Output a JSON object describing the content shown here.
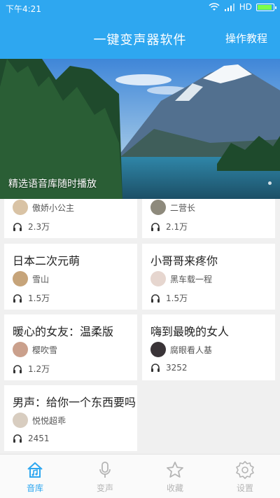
{
  "status": {
    "time": "下午4:21",
    "network": "HD"
  },
  "header": {
    "title": "一键变声器软件",
    "tutorial_label": "操作教程"
  },
  "banner": {
    "caption": "精选语音库随时播放"
  },
  "cards": [
    {
      "title": "",
      "author": "傲娇小公主",
      "plays": "2.3万"
    },
    {
      "title": "",
      "author": "二营长",
      "plays": "2.1万"
    },
    {
      "title": "日本二次元萌",
      "author": "雪山",
      "plays": "1.5万"
    },
    {
      "title": "小哥哥来疼你",
      "author": "黑车载一程",
      "plays": "1.5万"
    },
    {
      "title": "暖心的女友：温柔版",
      "author": "樱吹雪",
      "plays": "1.2万"
    },
    {
      "title": "嗨到最晚的女人",
      "author": "腐眼看人基",
      "plays": "3252"
    },
    {
      "title": "男声：给你一个东西要吗",
      "author": "悦悦超乖",
      "plays": "2451"
    }
  ],
  "nav": [
    {
      "label": "音库",
      "icon": "library-icon",
      "active": true
    },
    {
      "label": "变声",
      "icon": "microphone-icon",
      "active": false
    },
    {
      "label": "收藏",
      "icon": "star-icon",
      "active": false
    },
    {
      "label": "设置",
      "icon": "gear-icon",
      "active": false
    }
  ],
  "colors": {
    "accent": "#2ea7f0",
    "inactive": "#b5b5b5"
  }
}
